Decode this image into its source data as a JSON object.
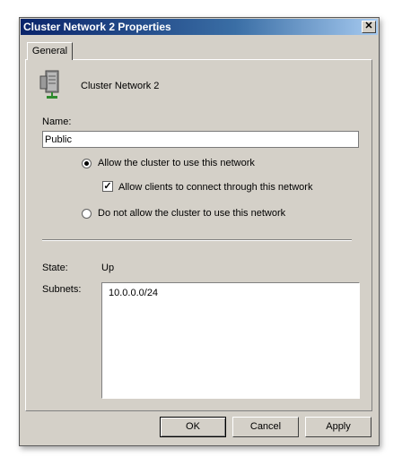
{
  "window": {
    "title": "Cluster Network 2 Properties",
    "close_glyph": "✕"
  },
  "tabs": [
    {
      "label": "General"
    }
  ],
  "general": {
    "network_name": "Cluster Network 2",
    "name_label": "Name:",
    "name_value": "Public",
    "radio_allow_label": "Allow the cluster to use this network",
    "checkbox_clients_label": "Allow clients to connect through this network",
    "radio_deny_label": "Do not allow the cluster to use this network",
    "state_label": "State:",
    "state_value": "Up",
    "subnets_label": "Subnets:",
    "subnets": [
      "10.0.0.0/24"
    ]
  },
  "buttons": {
    "ok": "OK",
    "cancel": "Cancel",
    "apply": "Apply"
  },
  "controls_state": {
    "allow_selected": true,
    "clients_checked": true,
    "deny_selected": false
  },
  "icons": {
    "network_server": "server-icon"
  }
}
